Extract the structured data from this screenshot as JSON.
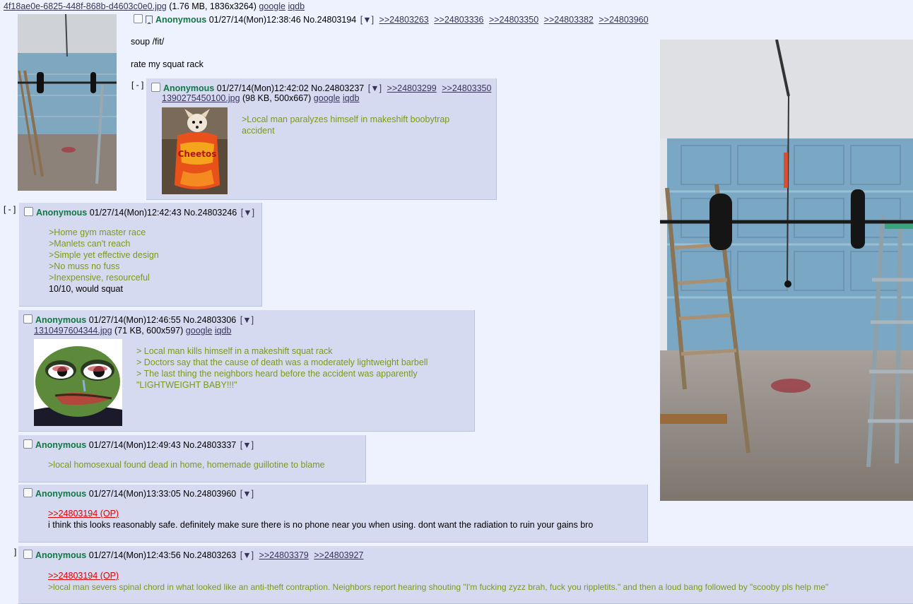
{
  "op": {
    "file_name": "4f18ae0e-6825-448f-868b-d4603c0e0.jpg",
    "file_meta": "(1.76 MB, 1836x3264)",
    "google": "google",
    "iqdb": "iqdb",
    "name": "Anonymous",
    "datetime": "01/27/14(Mon)12:38:46",
    "post_no": "No.24803194",
    "menu": "[▼]",
    "backlinks": [
      ">>24803263",
      ">>24803336",
      ">>24803350",
      ">>24803382",
      ">>24803960"
    ],
    "lines": [
      "soup /fit/",
      "rate my squat rack"
    ]
  },
  "replies": [
    {
      "name": "Anonymous",
      "datetime": "01/27/14(Mon)12:42:02",
      "post_no": "No.24803237",
      "menu": "[▼]",
      "backlinks": [
        ">>24803299",
        ">>24803350"
      ],
      "file_name": "1390275450100.jpg",
      "file_meta": "(98 KB, 500x667)",
      "google": "google",
      "iqdb": "iqdb",
      "lines": [
        ">Local man paralyzes himself in makeshift boobytrap",
        "accident"
      ]
    },
    {
      "name": "Anonymous",
      "datetime": "01/27/14(Mon)12:42:43",
      "post_no": "No.24803246",
      "menu": "[▼]",
      "quote_lines": [
        ">Home gym master race",
        ">Manlets can't reach",
        ">Simple yet effective design",
        ">No muss no fuss",
        ">Inexpensive, resourceful"
      ],
      "plain_line": "10/10, would squat"
    },
    {
      "name": "Anonymous",
      "datetime": "01/27/14(Mon)12:46:55",
      "post_no": "No.24803306",
      "menu": "[▼]",
      "file_name": "1310497604344.jpg",
      "file_meta": "(71 KB, 600x597)",
      "google": "google",
      "iqdb": "iqdb",
      "lines": [
        "> Local man kills himself in a makeshift squat rack",
        "> Doctors say that the cause of death was a moderately lightweight barbell",
        "> The last thing the neighbors heard before the accident was apparently",
        "\"LIGHTWEIGHT BABY!!!\""
      ]
    },
    {
      "name": "Anonymous",
      "datetime": "01/27/14(Mon)12:49:43",
      "post_no": "No.24803337",
      "menu": "[▼]",
      "lines": [
        ">local homosexual found dead in home, homemade guillotine to blame"
      ]
    },
    {
      "name": "Anonymous",
      "datetime": "01/27/14(Mon)13:33:05",
      "post_no": "No.24803960",
      "menu": "[▼]",
      "op_link": ">>24803194 (OP)",
      "text": "i think this looks reasonably safe. definitely make sure there is no phone near you when using. dont want the radiation to ruin your gains bro"
    },
    {
      "name": "Anonymous",
      "datetime": "01/27/14(Mon)12:43:56",
      "post_no": "No.24803263",
      "menu": "[▼]",
      "backlinks": [
        ">>24803379",
        ">>24803927"
      ],
      "op_link": ">>24803194 (OP)",
      "text": ">local man severs spinal chord in what looked like an anti-theft contraption. Neighbors report hearing shouting \"I'm fucking zyzz brah, fuck you rippletits.\" and then a loud bang followed by \"scooby pls help me\""
    }
  ],
  "ui": {
    "collapse": "[ - ]",
    "bracket": "]"
  },
  "image_labels": {
    "chips_bag": "Cheetos"
  },
  "colors": {
    "background": "#eef2ff",
    "reply_bg": "#d6daf0",
    "name": "#117743",
    "greentext": "#789922",
    "link": "#34345c",
    "op_link": "#dd0000"
  }
}
